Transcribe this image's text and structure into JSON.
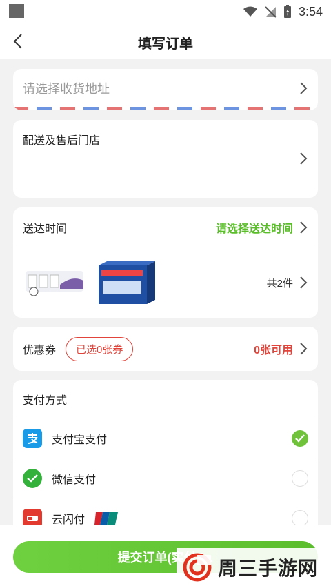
{
  "status_bar": {
    "time": "3:54"
  },
  "header": {
    "title": "填写订单"
  },
  "address": {
    "placeholder": "请选择收货地址"
  },
  "store": {
    "label": "配送及售后门店"
  },
  "delivery": {
    "label": "送达时间",
    "value": "请选择送达时间",
    "item_count": "共2件"
  },
  "coupon": {
    "label": "优惠券",
    "selected": "已选0张券",
    "available": "0张可用"
  },
  "payment": {
    "title": "支付方式",
    "methods": [
      {
        "label": "支付宝支付",
        "icon": "alipay-icon",
        "selected": true
      },
      {
        "label": "微信支付",
        "icon": "wechat-pay-icon",
        "selected": false
      },
      {
        "label": "云闪付",
        "icon": "unionpay-quickpass-icon",
        "selected": false
      }
    ]
  },
  "submit": {
    "label": "提交订单(实付¥..."
  },
  "watermark": {
    "text": "周三手游网"
  },
  "colors": {
    "accent_green": "#5bbd2b",
    "accent_red": "#e0443a"
  }
}
